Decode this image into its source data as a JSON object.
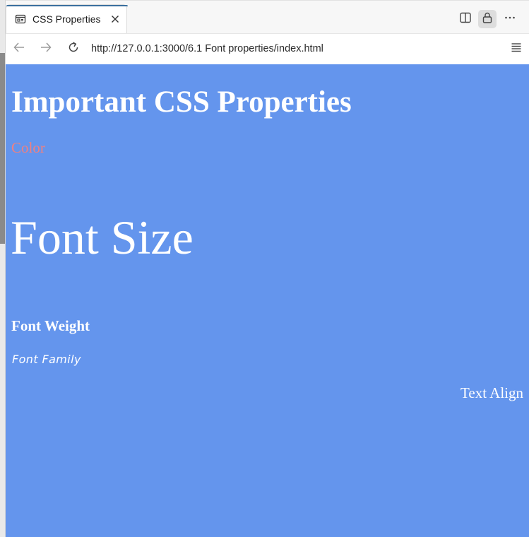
{
  "browser": {
    "tab": {
      "title": "CSS Properties",
      "icon": "page-icon",
      "close_icon": "close-icon"
    },
    "toolbar_icons": [
      "split-screen-icon",
      "lock-icon",
      "more-options-icon"
    ],
    "nav": {
      "back_icon": "back-arrow-icon",
      "forward_icon": "forward-arrow-icon",
      "reload_icon": "reload-icon",
      "url": "http://127.0.0.1:3000/6.1 Font properties/index.html",
      "reader_icon": "reader-mode-icon"
    }
  },
  "page": {
    "background_color": "#6495ed",
    "heading": "Important CSS Properties",
    "color_demo": {
      "text": "Color",
      "color": "#f08080"
    },
    "font_size_demo": "Font Size",
    "font_weight_demo": "Font Weight",
    "font_family_demo": "Font Family",
    "text_align_demo": "Text Align"
  }
}
